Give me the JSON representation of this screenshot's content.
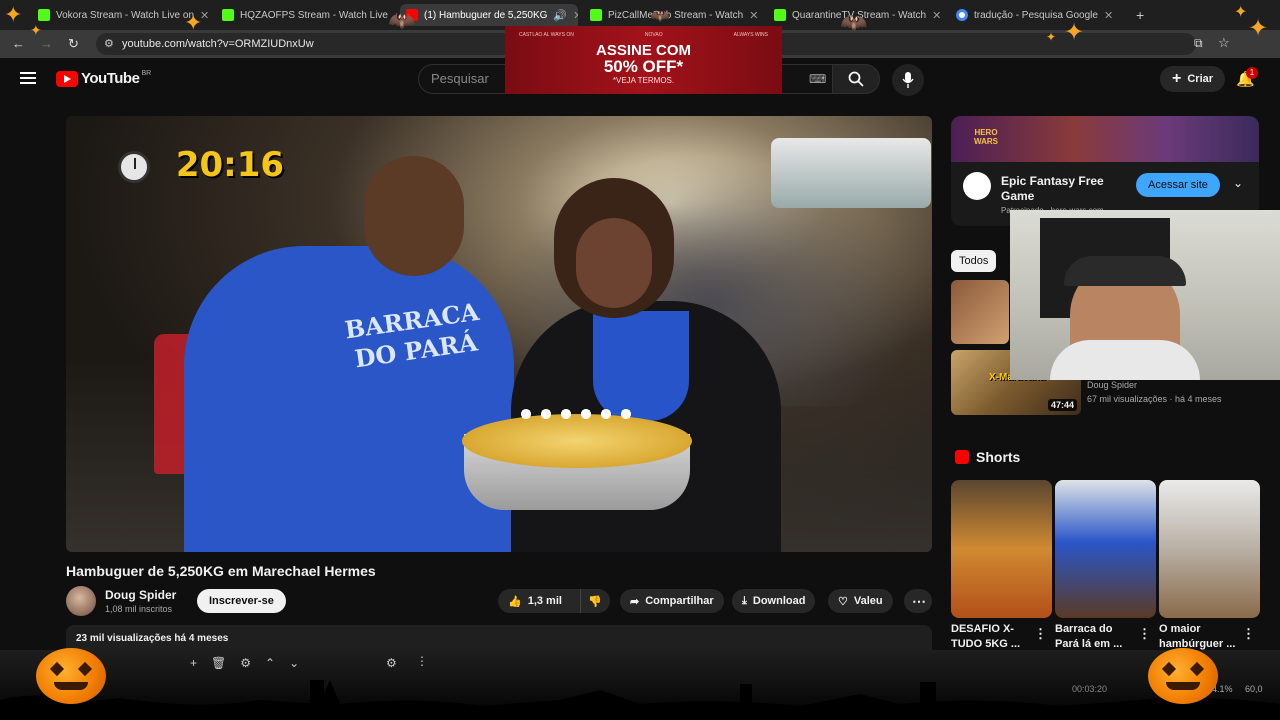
{
  "browser": {
    "tabs": [
      {
        "title": "Vokora Stream - Watch Live on",
        "fav": "#53fc18"
      },
      {
        "title": "HQZAOFPS Stream - Watch Live",
        "fav": "#53fc18"
      },
      {
        "title": "(1) Hambuguer de 5,250KG",
        "fav": "#ff0000"
      },
      {
        "title": "PizCallMeDub Stream - Watch",
        "fav": "#53fc18"
      },
      {
        "title": "QuarantineTV Stream - Watch",
        "fav": "#53fc18"
      },
      {
        "title": "tradução - Pesquisa Google",
        "fav": "#4285f4"
      }
    ],
    "close_glyph": "✕",
    "new_tab_glyph": "+",
    "url": "youtube.com/watch?v=ORMZIUDnxUw"
  },
  "youtube": {
    "logo_text": "YouTube",
    "logo_region": "BR",
    "search_placeholder": "Pesquisar",
    "create_label": "Criar",
    "notif_count": "1"
  },
  "ad_banner": {
    "small_left": "CASTLAO AL WAYS ON",
    "small_mid": "NOVAO",
    "small_right": "ALWAYS WINS",
    "line1": "ASSINE COM",
    "line2": "50% OFF*",
    "line3": "*VEJA TERMOS."
  },
  "video": {
    "overlay_timer": "20:16",
    "shirt_text": "BARRACA DO PARÁ",
    "title": "Hambuguer de 5,250KG em Marechael Hermes",
    "channel": "Doug Spider",
    "subscribers": "1,08 mil inscritos",
    "subscribe_label": "Inscrever-se",
    "likes": "1,3 mil",
    "share_label": "Compartilhar",
    "download_label": "Download",
    "thanks_label": "Valeu",
    "views_line": "23 mil visualizações  há 4 meses"
  },
  "sidebar": {
    "ad": {
      "title": "Epic Fantasy Free Game",
      "sponsored": "Patrocinado · hero-wars.com",
      "cta": "Acessar site",
      "brand": "HERO WARS"
    },
    "chips": [
      "Todos"
    ],
    "related": [
      {
        "channel": "Doug Spider",
        "meta": "67 mil visualizações · há 4 meses",
        "duration": "47:44",
        "thumb_text": "X-Maracanã"
      }
    ],
    "shorts_heading": "Shorts",
    "shorts": [
      {
        "title": "DESAFIO X-TUDO 5KG ..."
      },
      {
        "title": "Barraca do Pará lá em ..."
      },
      {
        "title": "O maior hambúrguer ..."
      }
    ]
  },
  "obs_bar": {
    "time": "00:03:20",
    "cpu": "4.1%",
    "fps": "60,0"
  },
  "colors": {
    "accent": "#3ea6ff",
    "yt_red": "#ff0000",
    "timer": "#f5c518",
    "pumpkin": "#f07b00"
  }
}
